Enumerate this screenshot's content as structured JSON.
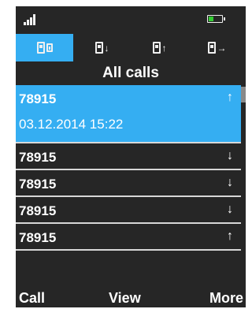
{
  "colors": {
    "screen_bg": "#262626",
    "accent": "#35aef2",
    "text": "#ffffff",
    "battery_level": "#33cc33"
  },
  "status_bar": {
    "signal_icon": "signal-bars-icon",
    "battery_icon": "battery-icon",
    "battery_level": 0.4
  },
  "tabs": [
    {
      "icon": "all-calls-icon",
      "active": true
    },
    {
      "icon": "incoming-calls-icon",
      "active": false
    },
    {
      "icon": "outgoing-calls-icon",
      "active": false
    },
    {
      "icon": "missed-calls-icon",
      "active": false
    }
  ],
  "title": "All calls",
  "calls": [
    {
      "number": "78915",
      "datetime": "03.12.2014 15:22",
      "direction": "outgoing",
      "arrow": "↑",
      "selected": true
    },
    {
      "number": "78915",
      "direction": "incoming",
      "arrow": "↓",
      "selected": false
    },
    {
      "number": "78915",
      "direction": "incoming",
      "arrow": "↓",
      "selected": false
    },
    {
      "number": "78915",
      "direction": "incoming",
      "arrow": "↓",
      "selected": false
    },
    {
      "number": "78915",
      "direction": "outgoing",
      "arrow": "↑",
      "selected": false
    }
  ],
  "softkeys": {
    "left": "Call",
    "center": "View",
    "right": "More"
  }
}
